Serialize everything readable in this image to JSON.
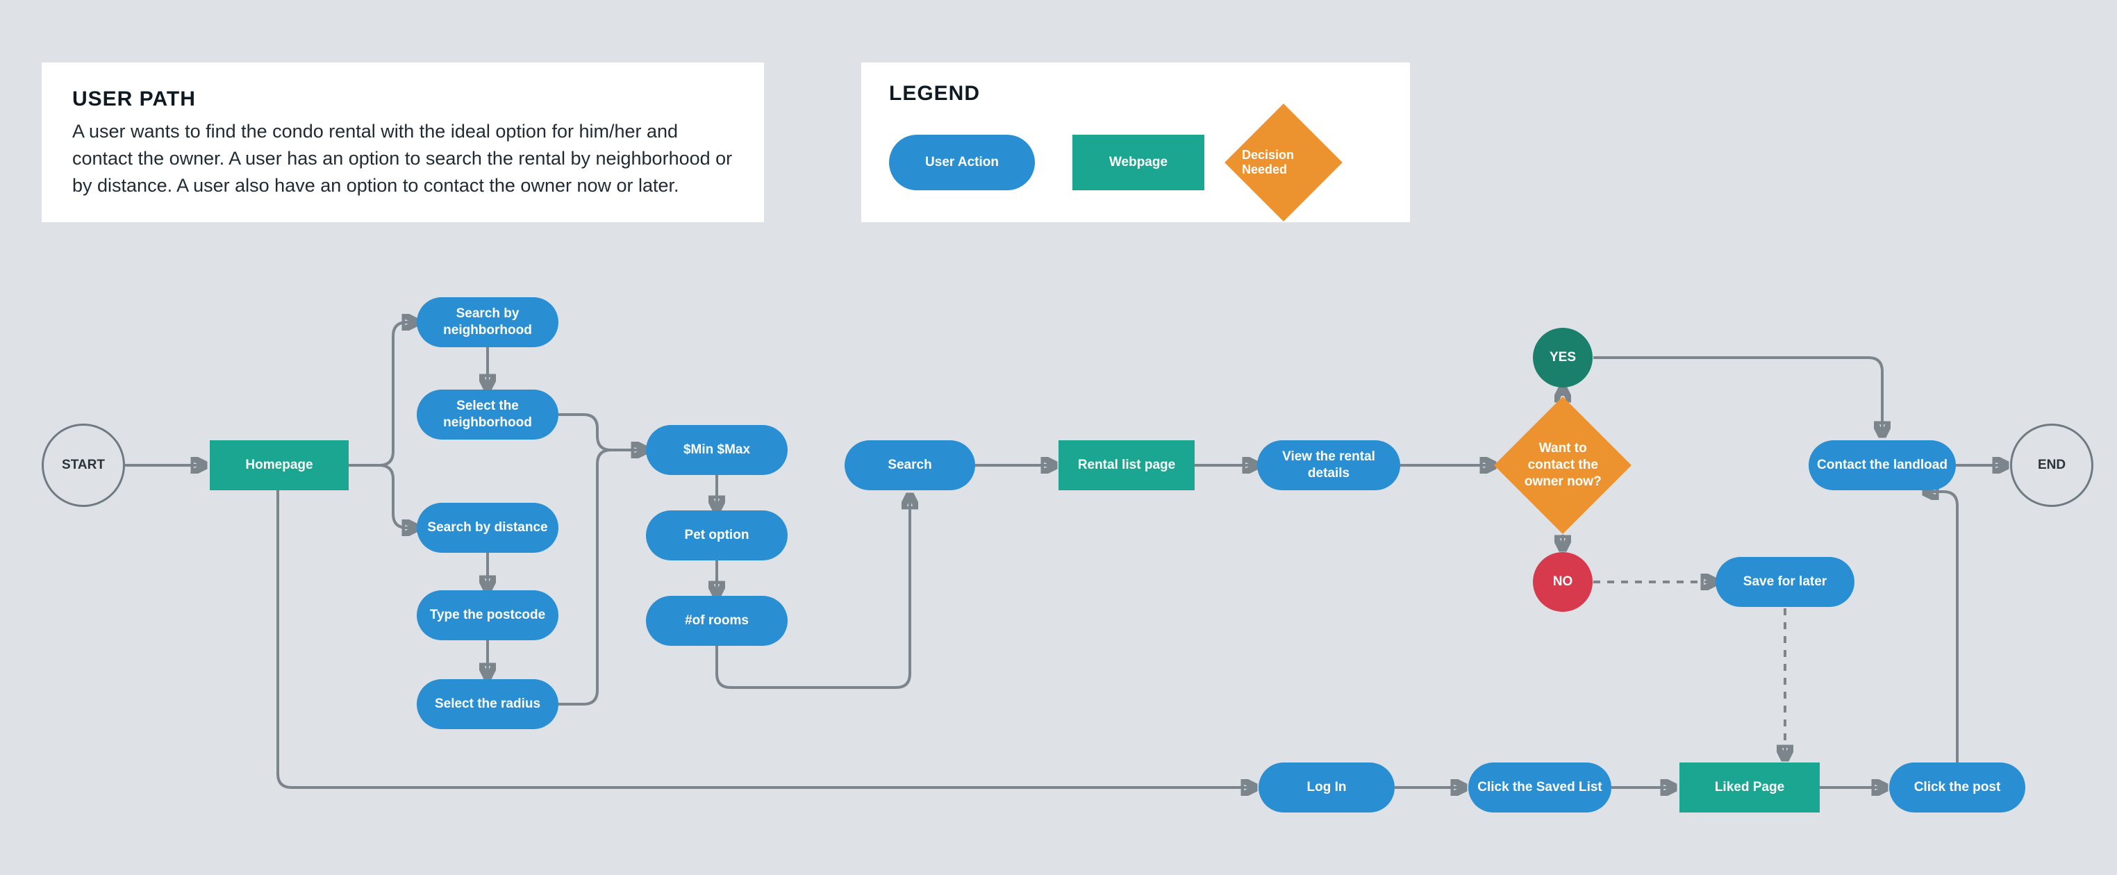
{
  "user_path": {
    "heading": "USER PATH",
    "body": "A user wants to find the condo rental with the ideal option for him/her and contact the owner. A user has an option to search the rental by neighborhood or by distance. A user also have an option to contact the owner now or later."
  },
  "legend": {
    "heading": "LEGEND",
    "user_action": "User Action",
    "webpage": "Webpage",
    "decision": "Decision Needed"
  },
  "nodes": {
    "start": "START",
    "end": "END",
    "homepage": "Homepage",
    "search_by_neighborhood": "Search by neighborhood",
    "select_neighborhood": "Select the neighborhood",
    "search_by_distance": "Search by distance",
    "type_postcode": "Type the postcode",
    "select_radius": "Select the radius",
    "min_max": "$Min $Max",
    "pet_option": "Pet option",
    "num_rooms": "#of rooms",
    "search": "Search",
    "rental_list_page": "Rental list page",
    "view_rental_details": "View the rental details",
    "decision_contact": "Want to contact the owner now?",
    "yes": "YES",
    "no": "NO",
    "contact_landlord": "Contact the landload",
    "save_for_later": "Save for later",
    "log_in": "Log In",
    "click_saved_list": "Click the Saved List",
    "liked_page": "Liked Page",
    "click_the_post": "Click the post"
  }
}
